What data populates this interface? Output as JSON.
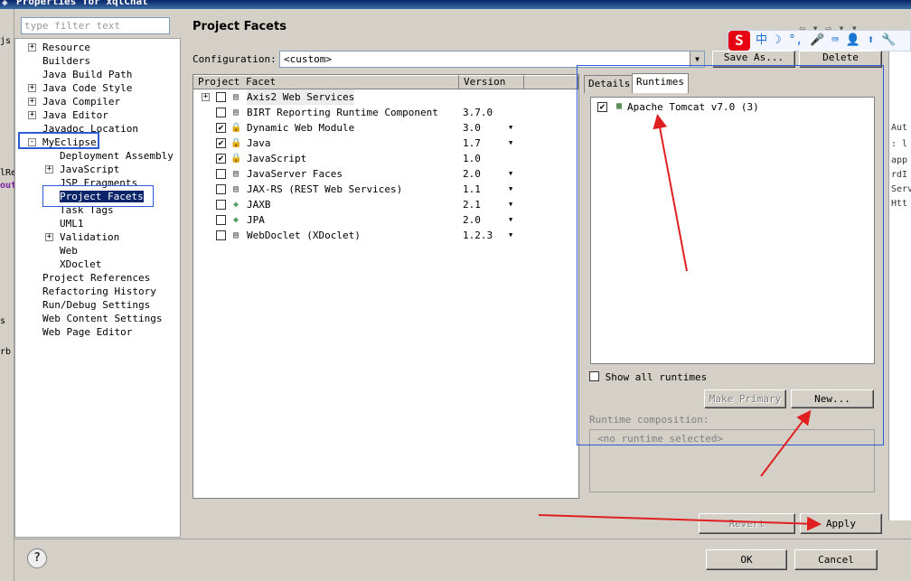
{
  "window": {
    "title": "Properties for xqlChat"
  },
  "filter": {
    "placeholder": "type filter text"
  },
  "tree": {
    "items": [
      {
        "label": "Resource",
        "expander": "+"
      },
      {
        "label": "Builders",
        "expander": ""
      },
      {
        "label": "Java Build Path",
        "expander": ""
      },
      {
        "label": "Java Code Style",
        "expander": "+"
      },
      {
        "label": "Java Compiler",
        "expander": "+"
      },
      {
        "label": "Java Editor",
        "expander": "+"
      },
      {
        "label": "Javadoc Location",
        "expander": ""
      },
      {
        "label": "MyEclipse",
        "expander": "-"
      },
      {
        "label": "Deployment Assembly",
        "expander": ""
      },
      {
        "label": "JavaScript",
        "expander": "+"
      },
      {
        "label": "JSP Fragments",
        "expander": ""
      },
      {
        "label": "Project Facets",
        "expander": ""
      },
      {
        "label": "Task Tags",
        "expander": ""
      },
      {
        "label": "UML1",
        "expander": ""
      },
      {
        "label": "Validation",
        "expander": "+"
      },
      {
        "label": "Web",
        "expander": ""
      },
      {
        "label": "XDoclet",
        "expander": ""
      },
      {
        "label": "Project References",
        "expander": ""
      },
      {
        "label": "Refactoring History",
        "expander": ""
      },
      {
        "label": "Run/Debug Settings",
        "expander": ""
      },
      {
        "label": "Web Content Settings",
        "expander": ""
      },
      {
        "label": "Web Page Editor",
        "expander": ""
      }
    ]
  },
  "page": {
    "title": "Project Facets"
  },
  "config": {
    "label": "Configuration:",
    "value": "<custom>",
    "save_as": "Save As...",
    "delete": "Delete"
  },
  "facets": {
    "col_facet": "Project Facet",
    "col_version": "Version",
    "rows": [
      {
        "name": "Axis2 Web Services",
        "version": "",
        "checked": false,
        "expander": "+",
        "icon": "page-icon",
        "dropdown": false
      },
      {
        "name": "BIRT Reporting Runtime Component",
        "version": "3.7.0",
        "checked": false,
        "expander": "",
        "icon": "page-icon",
        "dropdown": false
      },
      {
        "name": "Dynamic Web Module",
        "version": "3.0",
        "checked": true,
        "expander": "",
        "icon": "lock-icon",
        "dropdown": true
      },
      {
        "name": "Java",
        "version": "1.7",
        "checked": true,
        "expander": "",
        "icon": "lock-icon",
        "dropdown": true
      },
      {
        "name": "JavaScript",
        "version": "1.0",
        "checked": true,
        "expander": "",
        "icon": "lock-icon",
        "dropdown": false
      },
      {
        "name": "JavaServer Faces",
        "version": "2.0",
        "checked": false,
        "expander": "",
        "icon": "page-icon",
        "dropdown": true
      },
      {
        "name": "JAX-RS (REST Web Services)",
        "version": "1.1",
        "checked": false,
        "expander": "",
        "icon": "page-icon",
        "dropdown": true
      },
      {
        "name": "JAXB",
        "version": "2.1",
        "checked": false,
        "expander": "",
        "icon": "diamond-icon",
        "dropdown": true
      },
      {
        "name": "JPA",
        "version": "2.0",
        "checked": false,
        "expander": "",
        "icon": "diamond-icon",
        "dropdown": true
      },
      {
        "name": "WebDoclet (XDoclet)",
        "version": "1.2.3",
        "checked": false,
        "expander": "",
        "icon": "page-icon",
        "dropdown": true
      }
    ]
  },
  "runtimes": {
    "tab_details": "Details",
    "tab_runtimes": "Runtimes",
    "items": [
      {
        "label": "Apache Tomcat v7.0 (3)",
        "checked": true
      }
    ],
    "show_all": "Show all runtimes",
    "make_primary": "Make Primary",
    "new": "New...",
    "composition_label": "Runtime composition:",
    "composition_value": "<no runtime selected>"
  },
  "buttons": {
    "revert": "Revert",
    "apply": "Apply",
    "ok": "OK",
    "cancel": "Cancel"
  },
  "ime": {
    "label": "中"
  },
  "colors": {
    "selection": "#0a246a",
    "highlight_box": "#2b5bd7",
    "annotation": "#e02020"
  }
}
